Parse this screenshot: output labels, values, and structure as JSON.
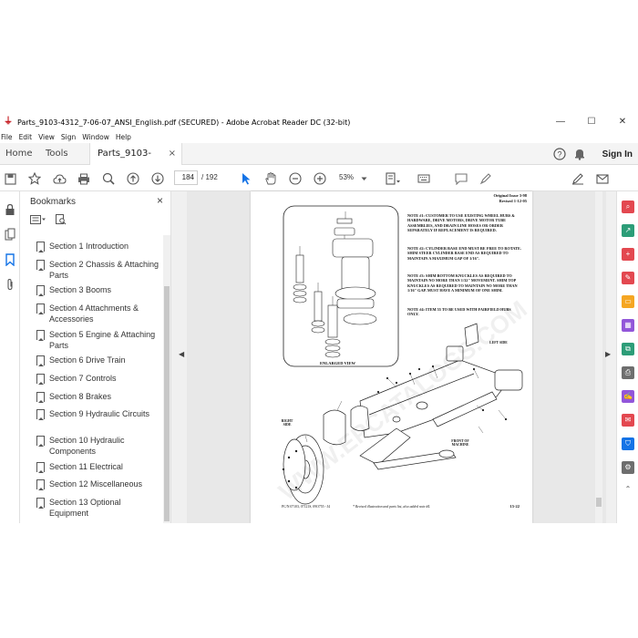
{
  "window": {
    "title": "Parts_9103-4312_7-06-07_ANSI_English.pdf (SECURED) - Adobe Acrobat Reader DC (32-bit)",
    "controls": [
      "—",
      "☐",
      "✕"
    ]
  },
  "menu": [
    "File",
    "Edit",
    "View",
    "Sign",
    "Window",
    "Help"
  ],
  "tabs": {
    "home": "Home",
    "tools": "Tools",
    "doc": "Parts_9103-4312_...",
    "doc_close": "×",
    "sign_in": "Sign In"
  },
  "toolbar": {
    "page_current": "184",
    "page_total": "/ 192",
    "zoom": "53%"
  },
  "bookmarks": {
    "header": "Bookmarks",
    "close": "×",
    "items": [
      "Section 1 Introduction",
      "Section 2 Chassis & Attaching Parts",
      "Section 3 Booms",
      "Section 4 Attachments & Accessories",
      "Section 5 Engine & Attaching Parts",
      "Section 6 Drive Train",
      "Section 7 Controls",
      "Section 8 Brakes",
      "Section 9 Hydraulic Circuits",
      "Section 10 Hydraulic Components",
      "Section 11 Electrical",
      "Section 12 Miscellaneous",
      "Section 13 Optional Equipment"
    ]
  },
  "pdf": {
    "issue": "Original Issue 3-98",
    "revised": "Revised 1-12-05",
    "note1": "NOTE #1: CUSTOMER TO USE EXISTING WHEEL HUBS & HARDWARE, DRIVE MOTORS, DRIVE MOTOR TUBE ASSEMBLIES, AND DRAIN LINE HOSES OR ORDER SEPARATELY IF REPLACEMENT IS REQUIRED.",
    "note2": "NOTE #2: CYLINDER BASE END MUST BE FREE TO ROTATE. SHIM STEER CYLINDER BASE END AS REQUIRED TO MAINTAIN A MAXIMUM GAP OF 1/16\".",
    "note3": "NOTE #3: SHIM BOTTOM KNUCKLES AS REQUIRED TO MAINTAIN NO MORE THAN 1/32\" MOVEMENT. SHIM TOP KNUCKLES AS REQUIRED TO MAINTAIN NO MORE THAN 1/16\" GAP. MUST HAVE A MINIMUM OF ONE SHIM.",
    "note4": "NOTE #4: ITEM 55 TO BE USED WITH FAIRFIELD HUBS ONLY.",
    "enlarged": "ENLARGED VIEW",
    "left_side": "LEFT SIDE",
    "right_side": "RIGHT SIDE",
    "front": "FRONT OF MACHINE",
    "footer_left": "PC/N 07103, 07121S, 09O755 - J4",
    "footer_mid": "* Revised illustration and parts list, also added note #4.",
    "footer_page": "15-22",
    "watermark": "WWW.EPCATALOGS.COM"
  }
}
